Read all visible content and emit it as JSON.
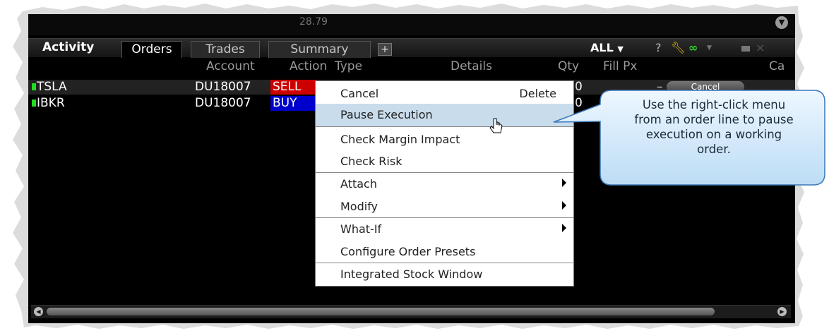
{
  "topstrip": {
    "number": "28.79"
  },
  "tabs": {
    "activity": "Activity",
    "items": [
      {
        "label": "Orders"
      },
      {
        "label": "Trades"
      },
      {
        "label": "Summary"
      }
    ],
    "add": "+"
  },
  "controls": {
    "filter": "ALL",
    "help": "?"
  },
  "columns": [
    "Account",
    "Action",
    "Type",
    "Details",
    "Qty",
    "Fill Px",
    "Ca"
  ],
  "orders": [
    {
      "symbol": "TSLA",
      "account": "DU18007",
      "action": "SELL",
      "qty": "0",
      "fill_px": "–",
      "cancel": "Cancel"
    },
    {
      "symbol": "IBKR",
      "account": "DU18007",
      "action": "BUY",
      "qty": "0"
    }
  ],
  "context_menu": {
    "items": [
      {
        "label": "Cancel",
        "shortcut": "Delete"
      },
      {
        "label": "Pause Execution"
      },
      {
        "label": "Check Margin Impact"
      },
      {
        "label": "Check Risk"
      },
      {
        "label": "Attach"
      },
      {
        "label": "Modify"
      },
      {
        "label": "What-If"
      },
      {
        "label": "Configure Order Presets"
      },
      {
        "label": "Integrated Stock Window"
      }
    ]
  },
  "callout": {
    "lines": [
      "Use the right-click menu",
      "from an order line to pause",
      "execution on a working",
      "order."
    ]
  },
  "colors": {
    "sell": "#cc0000",
    "buy": "#0000cc",
    "status_green": "#22dd22",
    "menu_highlight": "#c9dcec",
    "callout_fill": "#d8ecfb"
  },
  "icons": [
    "wrench-icon",
    "link-icon",
    "scroll-left-icon",
    "scroll-right-icon",
    "submenu-arrow-icon",
    "mouse-cursor-icon"
  ]
}
